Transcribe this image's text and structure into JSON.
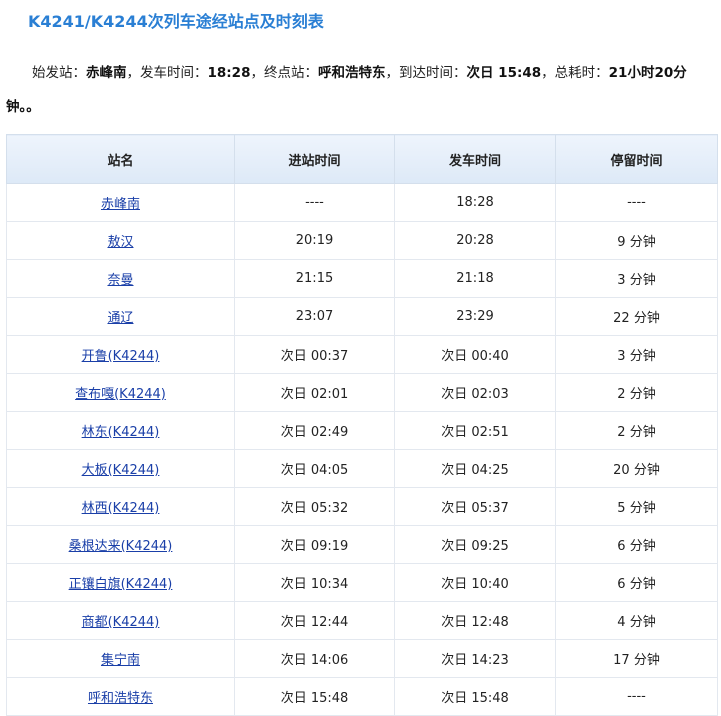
{
  "title": "K4241/K4244次列车途经站点及时刻表",
  "summary": {
    "start_label": "始发站：",
    "start_station": "赤峰南",
    "depart_label": "，发车时间：",
    "depart_time": "18:28",
    "end_label": "，终点站：",
    "end_station": "呼和浩特东",
    "arrive_label": "，到达时间：",
    "arrive_time": "次日 15:48",
    "duration_label": "，总耗时：",
    "duration": "21小时20分钟",
    "suffix": "。。"
  },
  "table": {
    "headers": [
      "站名",
      "进站时间",
      "发车时间",
      "停留时间"
    ],
    "rows": [
      {
        "station": "赤峰南",
        "arrive": "----",
        "depart": "18:28",
        "stay": "----"
      },
      {
        "station": "敖汉",
        "arrive": "20:19",
        "depart": "20:28",
        "stay": "9 分钟"
      },
      {
        "station": "奈曼",
        "arrive": "21:15",
        "depart": "21:18",
        "stay": "3 分钟"
      },
      {
        "station": "通辽",
        "arrive": "23:07",
        "depart": "23:29",
        "stay": "22 分钟"
      },
      {
        "station": "开鲁(K4244)",
        "arrive": "次日 00:37",
        "depart": "次日 00:40",
        "stay": "3 分钟"
      },
      {
        "station": "查布嘎(K4244)",
        "arrive": "次日 02:01",
        "depart": "次日 02:03",
        "stay": "2 分钟"
      },
      {
        "station": "林东(K4244)",
        "arrive": "次日 02:49",
        "depart": "次日 02:51",
        "stay": "2 分钟"
      },
      {
        "station": "大板(K4244)",
        "arrive": "次日 04:05",
        "depart": "次日 04:25",
        "stay": "20 分钟"
      },
      {
        "station": "林西(K4244)",
        "arrive": "次日 05:32",
        "depart": "次日 05:37",
        "stay": "5 分钟"
      },
      {
        "station": "桑根达来(K4244)",
        "arrive": "次日 09:19",
        "depart": "次日 09:25",
        "stay": "6 分钟"
      },
      {
        "station": "正镶白旗(K4244)",
        "arrive": "次日 10:34",
        "depart": "次日 10:40",
        "stay": "6 分钟"
      },
      {
        "station": "商都(K4244)",
        "arrive": "次日 12:44",
        "depart": "次日 12:48",
        "stay": "4 分钟"
      },
      {
        "station": "集宁南",
        "arrive": "次日 14:06",
        "depart": "次日 14:23",
        "stay": "17 分钟"
      },
      {
        "station": "呼和浩特东",
        "arrive": "次日 15:48",
        "depart": "次日 15:48",
        "stay": "----"
      }
    ]
  }
}
